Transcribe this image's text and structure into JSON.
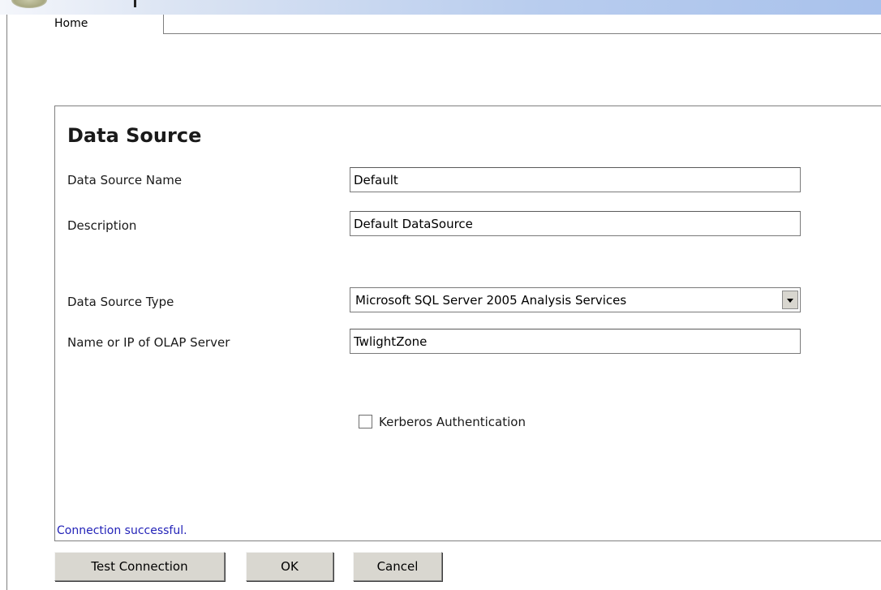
{
  "tabs": [
    {
      "label": "Home"
    }
  ],
  "form": {
    "title": "Data Source",
    "fields": {
      "name": {
        "label": "Data Source Name",
        "value": "Default"
      },
      "description": {
        "label": "Description",
        "value": "Default DataSource"
      },
      "type": {
        "label": "Data Source Type",
        "value": "Microsoft SQL Server 2005 Analysis Services"
      },
      "server": {
        "label": "Name or IP of OLAP Server",
        "value": "TwlightZone"
      }
    },
    "kerberos": {
      "label": "Kerberos Authentication",
      "checked": false
    },
    "status": "Connection successful."
  },
  "buttons": {
    "test": "Test Connection",
    "ok": "OK",
    "cancel": "Cancel"
  },
  "colors": {
    "status_text": "#2323b8",
    "button_face": "#d9d7d0",
    "topbar_accent": "#a9c2ec"
  },
  "icons": {
    "app_logo": "app-logo-icon",
    "dropdown": "chevron-down-icon"
  }
}
